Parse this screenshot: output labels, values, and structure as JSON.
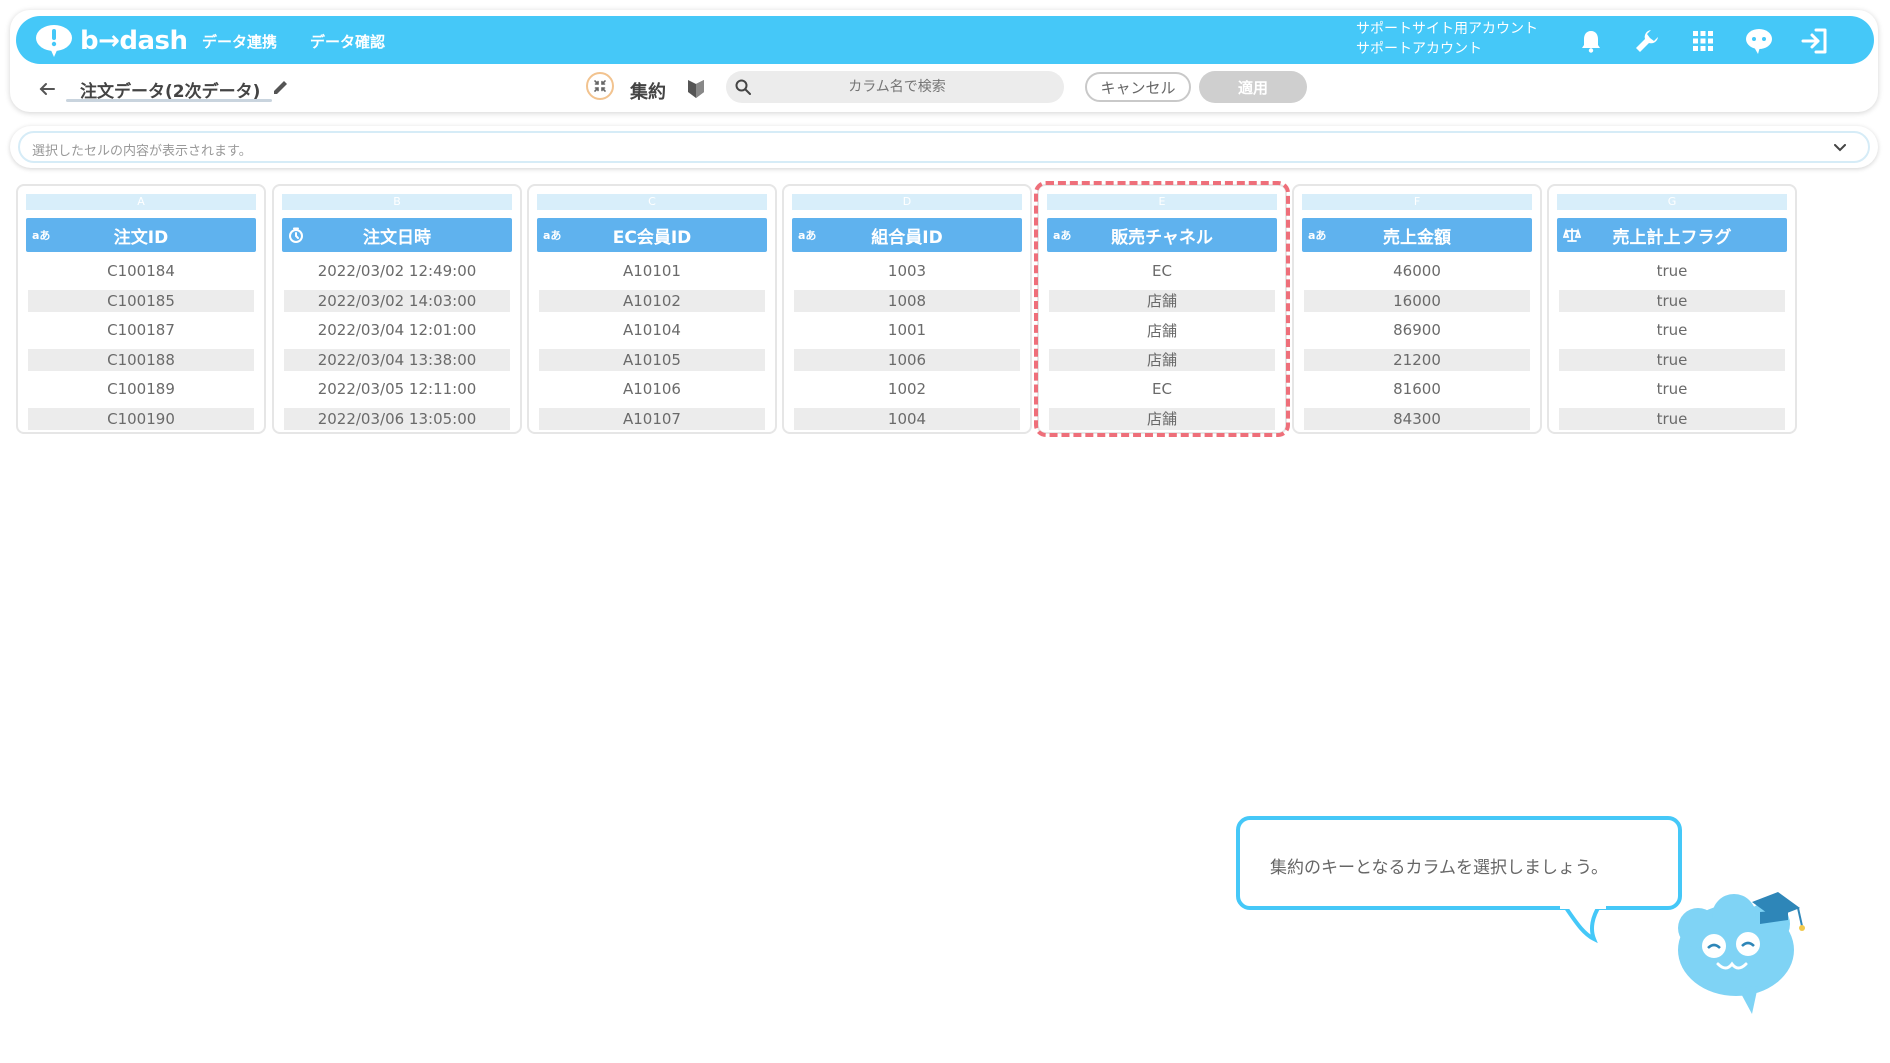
{
  "header": {
    "logo_text": "b→dash",
    "nav": [
      "データ連携",
      "データ確認"
    ],
    "account_line1": "サポートサイト用アカウント",
    "account_line2": "サポートアカウント",
    "icons": [
      "bell-icon",
      "wrench-icon",
      "apps-grid-icon",
      "chat-bot-icon",
      "logout-icon"
    ],
    "brand_color": "#45c8f8"
  },
  "subbar": {
    "title": "注文データ(2次データ)",
    "agg_label": "集約",
    "search_placeholder": "カラム名で検索",
    "cancel_label": "キャンセル",
    "apply_label": "適用"
  },
  "cellbar": {
    "placeholder": "選択したセルの内容が表示されます。"
  },
  "columns": [
    {
      "letter": "A",
      "type": "aあ",
      "name": "注文ID",
      "values": [
        "C100184",
        "C100185",
        "C100187",
        "C100188",
        "C100189",
        "C100190"
      ]
    },
    {
      "letter": "B",
      "type": "clock",
      "name": "注文日時",
      "values": [
        "2022/03/02 12:49:00",
        "2022/03/02 14:03:00",
        "2022/03/04 12:01:00",
        "2022/03/04 13:38:00",
        "2022/03/05 12:11:00",
        "2022/03/06 13:05:00"
      ]
    },
    {
      "letter": "C",
      "type": "aあ",
      "name": "EC会員ID",
      "values": [
        "A10101",
        "A10102",
        "A10104",
        "A10105",
        "A10106",
        "A10107"
      ]
    },
    {
      "letter": "D",
      "type": "aあ",
      "name": "組合員ID",
      "values": [
        "1003",
        "1008",
        "1001",
        "1006",
        "1002",
        "1004"
      ]
    },
    {
      "letter": "E",
      "type": "aあ",
      "name": "販売チャネル",
      "values": [
        "EC",
        "店舗",
        "店舗",
        "店舗",
        "EC",
        "店舗"
      ]
    },
    {
      "letter": "F",
      "type": "aあ",
      "name": "売上金額",
      "values": [
        "46000",
        "16000",
        "86900",
        "21200",
        "81600",
        "84300"
      ]
    },
    {
      "letter": "G",
      "type": "scale",
      "name": "売上計上フラグ",
      "values": [
        "true",
        "true",
        "true",
        "true",
        "true",
        "true"
      ]
    }
  ],
  "highlight_color": "#ee6f7a",
  "tutorial": {
    "message": "集約のキーとなるカラムを選択しましょう。"
  }
}
